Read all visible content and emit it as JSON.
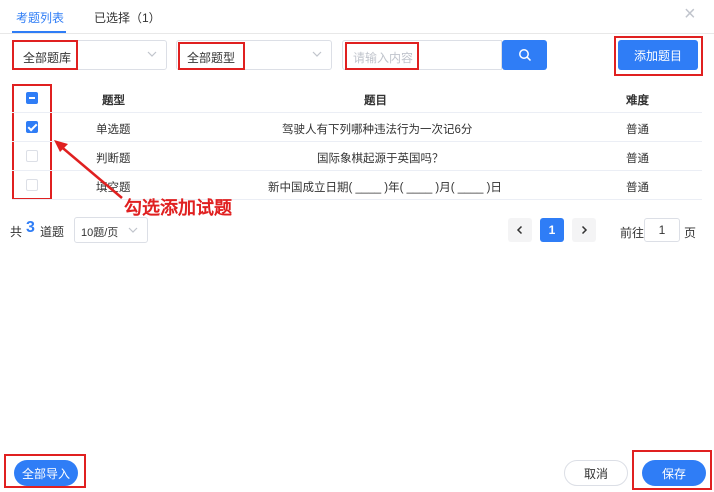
{
  "tabs": [
    {
      "label": "考题列表"
    },
    {
      "label": "已选择（1）"
    }
  ],
  "filters": {
    "bank": "全部题库",
    "type": "全部题型",
    "search_placeholder": "请输入内容",
    "add_button": "添加题目"
  },
  "table": {
    "headers": {
      "type": "题型",
      "question": "题目",
      "difficulty": "难度"
    },
    "rows": [
      {
        "type": "单选题",
        "question": "驾驶人有下列哪种违法行为一次记6分",
        "difficulty": "普通",
        "checked": true
      },
      {
        "type": "判断题",
        "question": "国际象棋起源于英国吗？",
        "difficulty": "普通",
        "checked": false
      },
      {
        "type": "填空题",
        "question": "新中国成立日期( ____ )年( ____ )月( ____ )日",
        "difficulty": "普通",
        "checked": false
      }
    ]
  },
  "annotation": "勾选添加试题",
  "pagination": {
    "total_prefix": "共",
    "total": "3",
    "total_suffix": "道题",
    "page_size": "10题/页",
    "current_page": "1",
    "goto_prefix": "前往",
    "goto_value": "1",
    "goto_suffix": "页"
  },
  "footer": {
    "import_all": "全部导入",
    "cancel": "取消",
    "save": "保存"
  },
  "colors": {
    "accent": "#2f7df6",
    "annotation_red": "#e02020"
  }
}
